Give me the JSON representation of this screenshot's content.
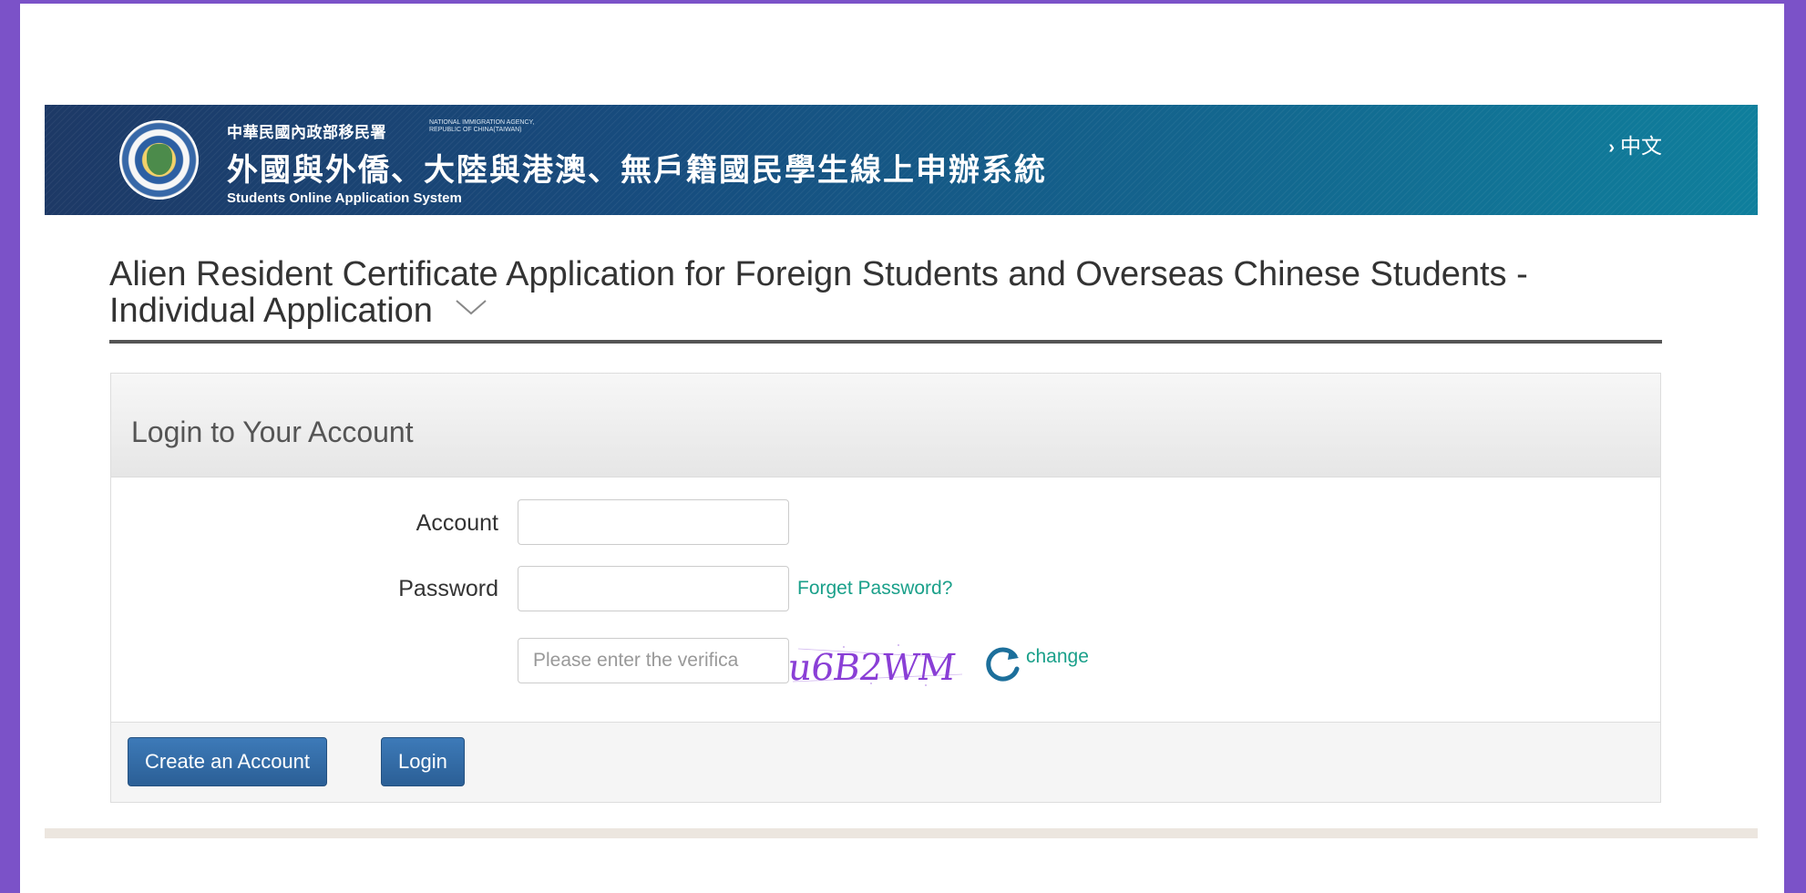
{
  "header": {
    "agency_zh": "中華民國內政部移民署",
    "agency_en_line1": "NATIONAL IMMIGRATION AGENCY,",
    "agency_en_line2": "REPUBLIC OF CHINA(TAIWAN)",
    "system_title_zh": "外國與外僑、大陸與港澳、無戶籍國民學生線上申辦系統",
    "system_title_en": "Students Online Application System",
    "language_link": "中文"
  },
  "page": {
    "heading": "Alien Resident Certificate Application for Foreign Students and Overseas Chinese Students - Individual Application"
  },
  "login": {
    "panel_title": "Login to Your Account",
    "account_label": "Account",
    "account_value": "",
    "password_label": "Password",
    "password_value": "",
    "forget_password": "Forget Password?",
    "verification_placeholder": "Please enter the verifica",
    "captcha_text": "u6B2WM",
    "change_label": "change",
    "create_account_button": "Create an Account",
    "login_button": "Login"
  },
  "colors": {
    "frame": "#7b52c8",
    "banner_left": "#1d3966",
    "banner_right": "#0f7f9c",
    "link": "#1aa08a",
    "button": "#2f6aa5",
    "captcha": "#8a3fd6"
  },
  "icons": {
    "language": "chevron-right-icon",
    "expand": "chevron-down-icon",
    "refresh": "refresh-icon"
  }
}
